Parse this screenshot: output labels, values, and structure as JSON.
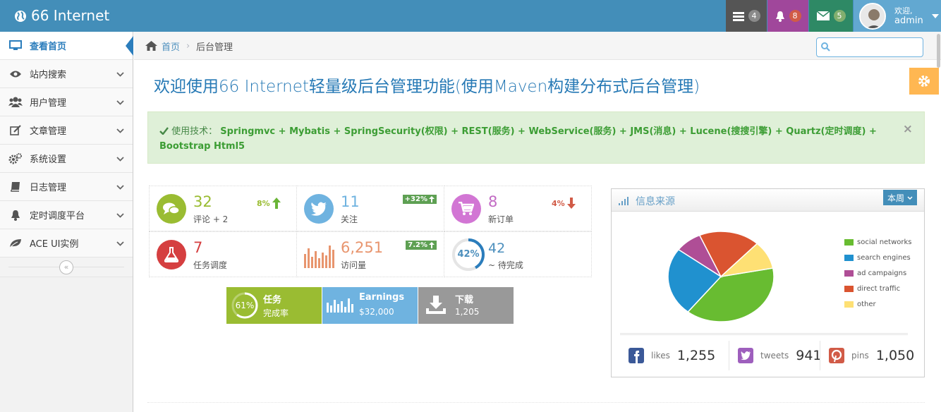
{
  "brand": {
    "title": "66 Internet"
  },
  "navbar": {
    "tasks_count": "4",
    "notifications_count": "8",
    "messages_count": "5",
    "user_greeting": "欢迎,",
    "user_name": "admin"
  },
  "sidebar": {
    "items": [
      {
        "label": "查看首页",
        "icon": "monitor-icon"
      },
      {
        "label": "站内搜索",
        "icon": "eye-icon"
      },
      {
        "label": "用户管理",
        "icon": "users-icon"
      },
      {
        "label": "文章管理",
        "icon": "edit-icon"
      },
      {
        "label": "系统设置",
        "icon": "cogs-icon"
      },
      {
        "label": "日志管理",
        "icon": "book-icon"
      },
      {
        "label": "定时调度平台",
        "icon": "bell-icon"
      },
      {
        "label": "ACE UI实例",
        "icon": "leaf-icon"
      }
    ],
    "collapse_glyph": "«"
  },
  "breadcrumb": {
    "home": "首页",
    "current": "后台管理"
  },
  "search": {
    "placeholder": ""
  },
  "main": {
    "title": "欢迎使用66 Internet轻量级后台管理功能(使用Maven构建分布式后台管理)",
    "alert_prefix": "使用技术：",
    "alert_tech": "Springmvc + Mybatis + SpringSecurity(权限) + REST(服务) + WebService(服务) + JMS(消息) + Lucene(搜搜引擎) + Quartz(定时调度) + Bootstrap Html5",
    "alert_close": "×"
  },
  "infoboxes": [
    {
      "number": "32",
      "label": "评论 + 2",
      "stat": "8%",
      "color": "#6fb3e0"
    },
    {
      "number": "11",
      "label": "关注",
      "stat": "+32%",
      "color": "#6fb3e0"
    },
    {
      "number": "8",
      "label": "新订单",
      "stat": "4%",
      "color": "#d15b47"
    },
    {
      "number": "7",
      "label": "任务调度",
      "color": "#c33"
    },
    {
      "number": "6,251",
      "label": "访问量",
      "stat": "7.2%",
      "color": "#e8956e"
    },
    {
      "number": "42",
      "label": "~ 待完成",
      "progress": "42%",
      "progress_value": 42
    }
  ],
  "tiles": [
    {
      "title": "任务",
      "sub": "完成率",
      "progress": "61%",
      "progress_value": 61
    },
    {
      "title": "Earnings",
      "sub": "$32,000"
    },
    {
      "title": "下载",
      "sub": "1,205"
    }
  ],
  "widget": {
    "title": "信息来源",
    "dropdown": "本周",
    "social": [
      {
        "label": "likes",
        "value": "1,255"
      },
      {
        "label": "tweets",
        "value": "941"
      },
      {
        "label": "pins",
        "value": "1,050"
      }
    ]
  },
  "chart_data": {
    "type": "pie",
    "title": "",
    "slices": [
      {
        "label": "social networks",
        "value": 38.7,
        "color": "#68bc31"
      },
      {
        "label": "search engines",
        "value": 24.5,
        "color": "#2091cf"
      },
      {
        "label": "ad campaigns",
        "value": 8.2,
        "color": "#af4e96"
      },
      {
        "label": "direct traffic",
        "value": 18.6,
        "color": "#da5430"
      },
      {
        "label": "other",
        "value": 10.0,
        "color": "#fee074"
      }
    ]
  }
}
